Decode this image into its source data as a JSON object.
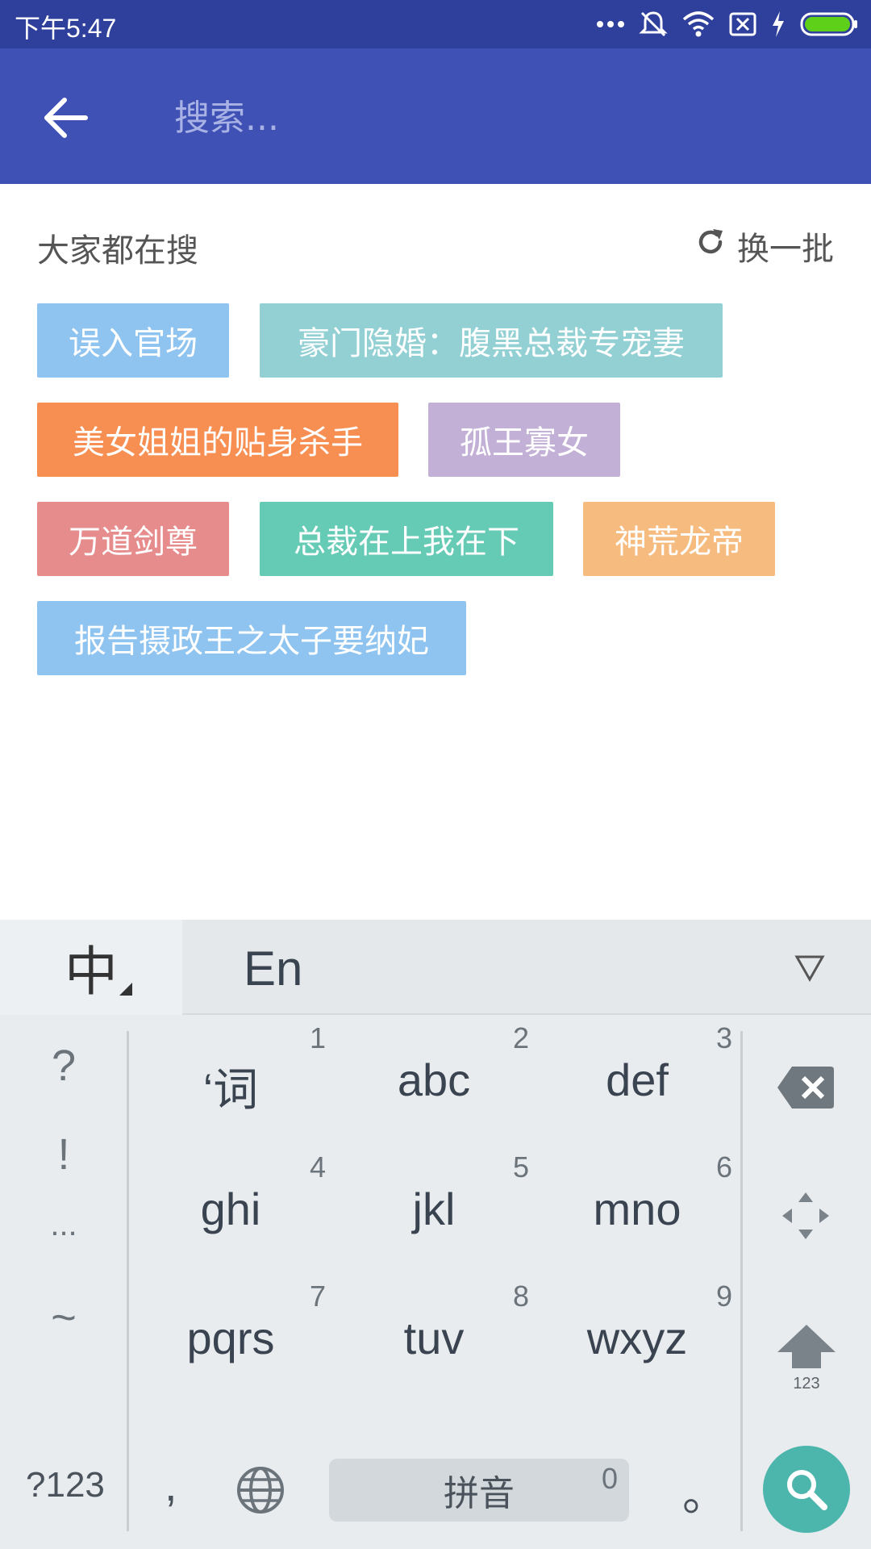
{
  "status_bar": {
    "time": "下午5:47",
    "icons": [
      "more-dots-icon",
      "mute-icon",
      "wifi-icon",
      "no-sim-icon",
      "charging-icon",
      "battery-icon"
    ],
    "battery_color": "#5fd019"
  },
  "app_bar": {
    "background": "#3f51b5",
    "back_icon": "arrow-back-icon",
    "search_placeholder": "搜索..."
  },
  "hot_search": {
    "title": "大家都在搜",
    "refresh_label": "换一批",
    "refresh_icon": "refresh-icon",
    "tags": [
      {
        "label": "误入官场",
        "color": "#90c4f0"
      },
      {
        "label": "豪门隐婚：腹黑总裁专宠妻",
        "color": "#92d0d4"
      },
      {
        "label": "美女姐姐的贴身杀手",
        "color": "#f78f52"
      },
      {
        "label": "孤王寡女",
        "color": "#c2b0d6"
      },
      {
        "label": "万道剑尊",
        "color": "#e78c8c"
      },
      {
        "label": "总裁在上我在下",
        "color": "#66cbb5"
      },
      {
        "label": "神荒龙帝",
        "color": "#f6bb7e"
      },
      {
        "label": "报告摄政王之太子要纳妃",
        "color": "#90c4f0"
      }
    ]
  },
  "keyboard": {
    "lang_cn": "中",
    "lang_en": "En",
    "symbols": [
      "?",
      "!",
      "...",
      "~"
    ],
    "keys": [
      {
        "label": "‘词",
        "num": "1"
      },
      {
        "label": "abc",
        "num": "2"
      },
      {
        "label": "def",
        "num": "3"
      },
      {
        "label": "ghi",
        "num": "4"
      },
      {
        "label": "jkl",
        "num": "5"
      },
      {
        "label": "mno",
        "num": "6"
      },
      {
        "label": "pqrs",
        "num": "7"
      },
      {
        "label": "tuv",
        "num": "8"
      },
      {
        "label": "wxyz",
        "num": "9"
      }
    ],
    "shift_label": "123",
    "mode_key": "?123",
    "comma": ",",
    "space_label": "拼音",
    "space_num": "0",
    "period": "。",
    "search_color": "#4db6ac"
  }
}
